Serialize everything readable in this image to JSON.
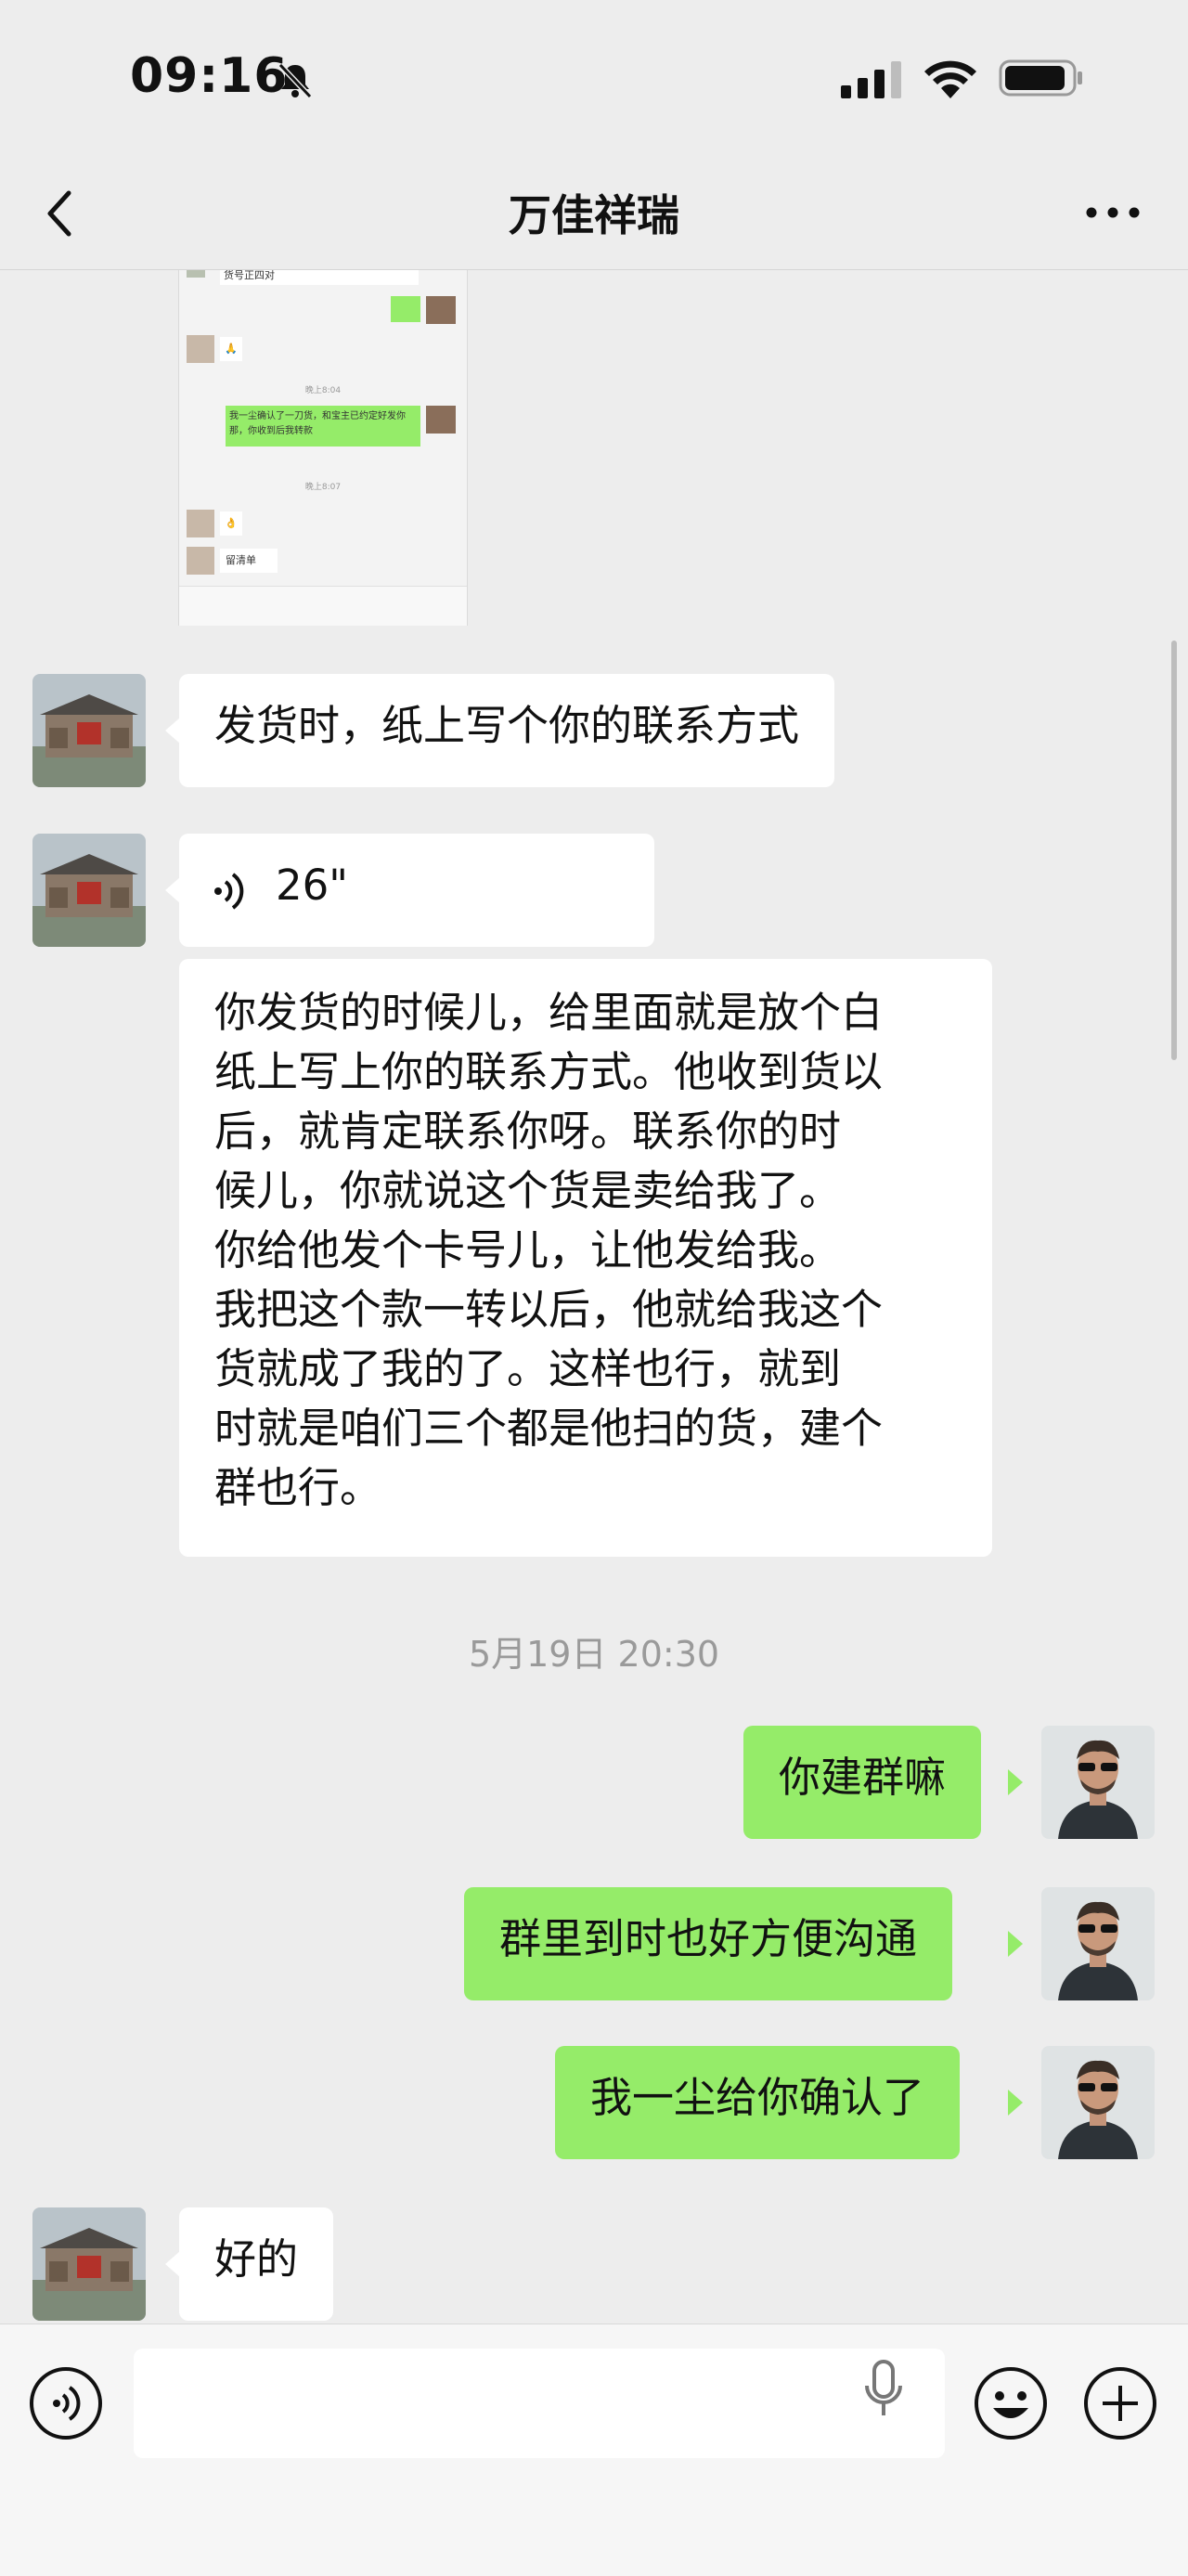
{
  "status": {
    "time": "09:16"
  },
  "nav": {
    "title": "万佳祥瑞"
  },
  "screenshot_preview": {
    "line_top": "货号正四对",
    "time1": "晚上8:04",
    "green_msg": "我一尘确认了一刀货，和宝主已约定好发你那，你收到后我转款",
    "time2": "晚上8:07",
    "list_msg": "留清单"
  },
  "messages": [
    {
      "side": "in",
      "type": "text",
      "text": "发货时，纸上写个你的联系方式"
    },
    {
      "side": "in",
      "type": "voice",
      "duration": "26\"",
      "transcript": "你发货的时候儿，给里面就是放个白纸上写上你的联系方式。他收到货以后，就肯定联系你呀。联系你的时候儿，你就说这个货是卖给我了。你给他发个卡号儿，让他发给我。我把这个款一转以后，他就给我这个货就成了我的了。这样也行，就到时就是咱们三个都是他扫的货，建个群也行。"
    },
    {
      "type": "timestamp",
      "text": "5月19日 20:30"
    },
    {
      "side": "out",
      "type": "text",
      "text": "你建群嘛"
    },
    {
      "side": "out",
      "type": "text",
      "text": "群里到时也好方便沟通"
    },
    {
      "side": "out",
      "type": "text",
      "text": "我一尘给你确认了"
    },
    {
      "side": "in",
      "type": "text",
      "text": "好的"
    }
  ],
  "transcript_lines": [
    "你发货的时候儿，给里面就是放个白",
    "纸上写上你的联系方式。他收到货以",
    "后，就肯定联系你呀。联系你的时",
    "候儿，你就说这个货是卖给我了。",
    "你给他发个卡号儿，让他发给我。",
    "我把这个款一转以后，他就给我这个",
    "货就成了我的了。这样也行，就到",
    "时就是咱们三个都是他扫的货，建个",
    "群也行。"
  ],
  "colors": {
    "outgoing_bubble": "#95ec69",
    "incoming_bubble": "#ffffff",
    "background": "#ededed"
  }
}
